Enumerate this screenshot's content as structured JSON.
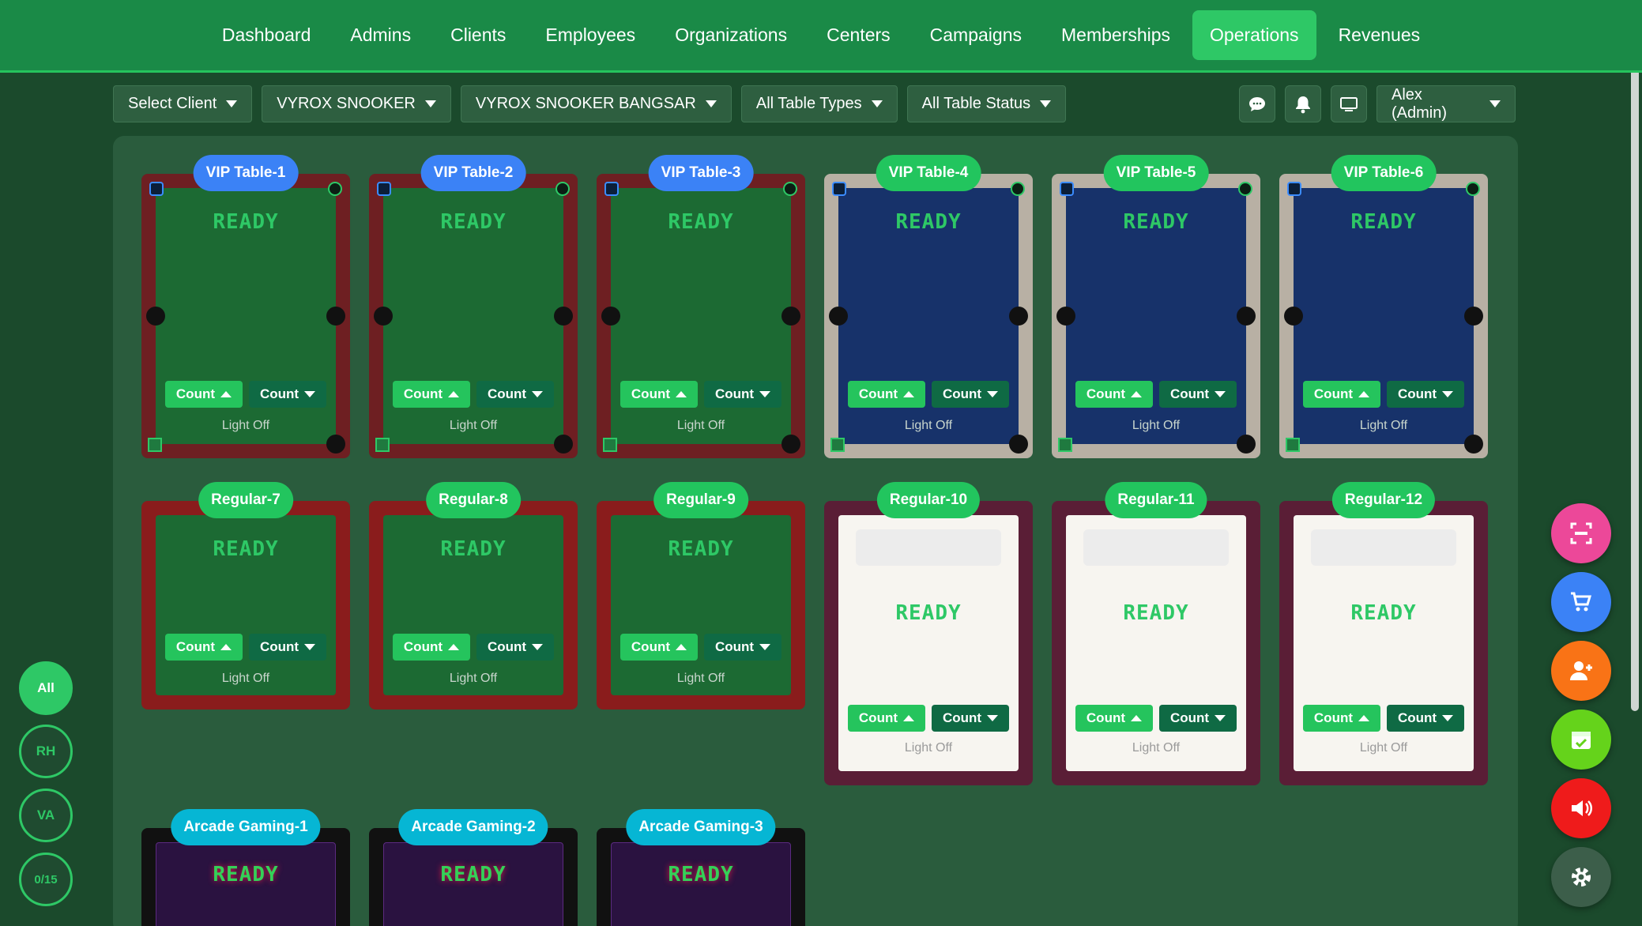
{
  "nav": {
    "items": [
      "Dashboard",
      "Admins",
      "Clients",
      "Employees",
      "Organizations",
      "Centers",
      "Campaigns",
      "Memberships",
      "Operations",
      "Revenues"
    ],
    "active": "Operations"
  },
  "filters": {
    "client": "Select Client",
    "organization": "VYROX SNOOKER",
    "center": "VYROX SNOOKER BANGSAR",
    "table_types": "All Table Types",
    "table_status": "All Table Status"
  },
  "user": {
    "name": "Alex (Admin)"
  },
  "tables": [
    {
      "name": "VIP Table-1",
      "status": "READY",
      "light": "Light Off",
      "count_up": "Count",
      "count_down": "Count"
    },
    {
      "name": "VIP Table-2",
      "status": "READY",
      "light": "Light Off",
      "count_up": "Count",
      "count_down": "Count"
    },
    {
      "name": "VIP Table-3",
      "status": "READY",
      "light": "Light Off",
      "count_up": "Count",
      "count_down": "Count"
    },
    {
      "name": "VIP Table-4",
      "status": "READY",
      "light": "Light Off",
      "count_up": "Count",
      "count_down": "Count"
    },
    {
      "name": "VIP Table-5",
      "status": "READY",
      "light": "Light Off",
      "count_up": "Count",
      "count_down": "Count"
    },
    {
      "name": "VIP Table-6",
      "status": "READY",
      "light": "Light Off",
      "count_up": "Count",
      "count_down": "Count"
    },
    {
      "name": "Regular-7",
      "status": "READY",
      "light": "Light Off",
      "count_up": "Count",
      "count_down": "Count"
    },
    {
      "name": "Regular-8",
      "status": "READY",
      "light": "Light Off",
      "count_up": "Count",
      "count_down": "Count"
    },
    {
      "name": "Regular-9",
      "status": "READY",
      "light": "Light Off",
      "count_up": "Count",
      "count_down": "Count"
    },
    {
      "name": "Regular-10",
      "status": "READY",
      "light": "Light Off",
      "count_up": "Count",
      "count_down": "Count"
    },
    {
      "name": "Regular-11",
      "status": "READY",
      "light": "Light Off",
      "count_up": "Count",
      "count_down": "Count"
    },
    {
      "name": "Regular-12",
      "status": "READY",
      "light": "Light Off",
      "count_up": "Count",
      "count_down": "Count"
    },
    {
      "name": "Arcade Gaming-1",
      "status": "READY"
    },
    {
      "name": "Arcade Gaming-2",
      "status": "READY"
    },
    {
      "name": "Arcade Gaming-3",
      "status": "READY"
    }
  ],
  "side_filters": [
    "All",
    "RH",
    "VA",
    "0/15"
  ],
  "fab": [
    "scan-icon",
    "cart-icon",
    "add-user-icon",
    "calendar-icon",
    "speaker-icon",
    "gear-icon"
  ],
  "colors": {
    "nav_bg": "#1a8a47",
    "board_bg": "#2a5c3d",
    "accent": "#2ec866",
    "vip_label": "#3b82f6",
    "regular_label": "#22c55e",
    "arcade_label": "#06b6d4"
  }
}
